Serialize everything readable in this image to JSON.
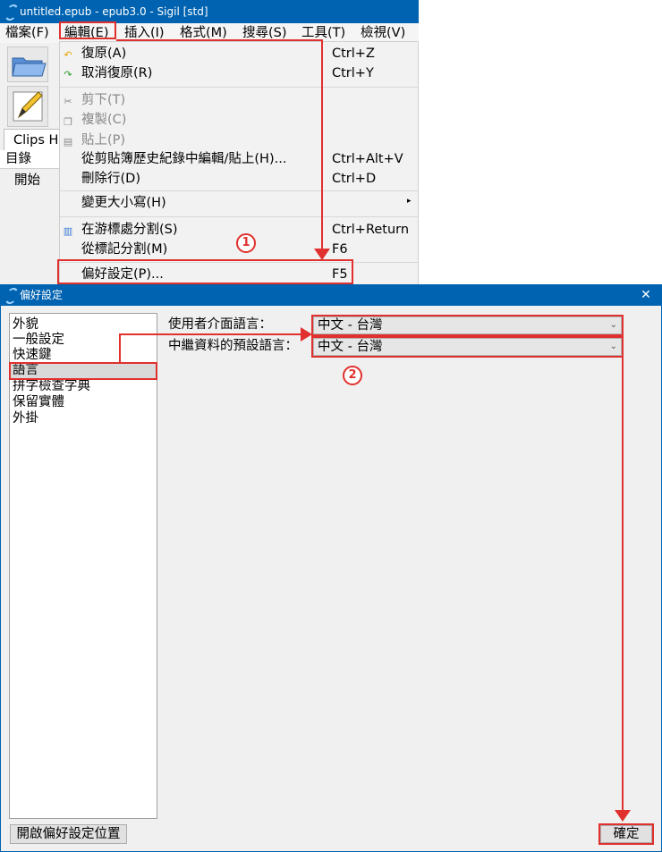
{
  "main_window": {
    "title": "untitled.epub - epub3.0 - Sigil [std]",
    "menubar": [
      {
        "label": "檔案(F)"
      },
      {
        "label": "編輯(E)"
      },
      {
        "label": "插入(I)"
      },
      {
        "label": "格式(M)"
      },
      {
        "label": "搜尋(S)"
      },
      {
        "label": "工具(T)"
      },
      {
        "label": "檢視(V)"
      }
    ],
    "clips_tab": "Clips H",
    "toc_header": "目錄",
    "toc_item": "開始"
  },
  "edit_menu": {
    "items": [
      {
        "label": "復原(A)",
        "shortcut": "Ctrl+Z",
        "icon": "undo-icon"
      },
      {
        "label": "取消復原(R)",
        "shortcut": "Ctrl+Y",
        "icon": "redo-icon"
      },
      {
        "label": "剪下(T)",
        "shortcut": "",
        "icon": "scissors-icon"
      },
      {
        "label": "複製(C)",
        "shortcut": "",
        "icon": "copy-icon"
      },
      {
        "label": "貼上(P)",
        "shortcut": "",
        "icon": "paste-icon"
      },
      {
        "label": "從剪貼簿歷史紀錄中編輯/貼上(H)...",
        "shortcut": "Ctrl+Alt+V"
      },
      {
        "label": "刪除行(D)",
        "shortcut": "Ctrl+D"
      },
      {
        "label": "變更大小寫(H)",
        "shortcut": ""
      },
      {
        "label": "在游標處分割(S)",
        "shortcut": "Ctrl+Return",
        "icon": "split-icon"
      },
      {
        "label": "從標記分割(M)",
        "shortcut": "F6"
      },
      {
        "label": "偏好設定(P)...",
        "shortcut": "F5"
      }
    ]
  },
  "annotations": {
    "step1": "1",
    "step2": "2"
  },
  "preferences_dialog": {
    "title": "偏好設定",
    "categories": [
      {
        "label": "外貌"
      },
      {
        "label": "一般設定"
      },
      {
        "label": "快速鍵"
      },
      {
        "label": "語言"
      },
      {
        "label": "拼字檢查字典"
      },
      {
        "label": "保留實體"
      },
      {
        "label": "外掛"
      }
    ],
    "selected_category": "語言",
    "ui_language_label": "使用者介面語言：",
    "ui_language_value": "中文 - 台灣",
    "metadata_language_label": "中繼資料的預設語言：",
    "metadata_language_value": "中文 - 台灣",
    "open_location_button": "開啟偏好設定位置",
    "ok_button": "確定"
  },
  "colors": {
    "title_bar": "#0063b1",
    "annotation_red": "#e0312e"
  }
}
